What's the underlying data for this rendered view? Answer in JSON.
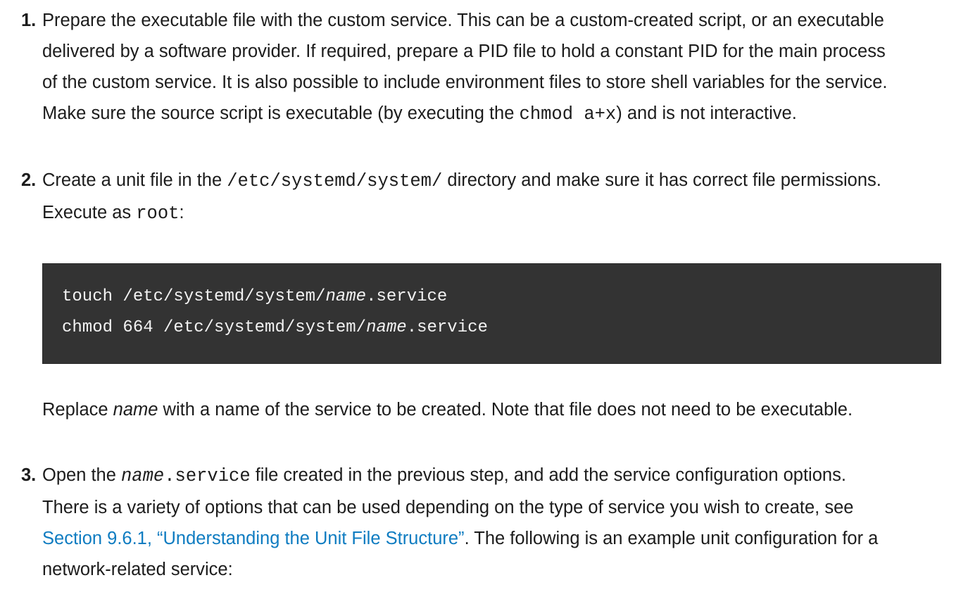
{
  "steps": [
    {
      "number": "1.",
      "lines": {
        "l1": "Prepare the executable file with the custom service. This can be a custom-created script, or an executable",
        "l2": "delivered by a software provider. If required, prepare a PID file to hold a constant PID for the main process",
        "l3": "of the custom service. It is also possible to include environment files to store shell variables for the service.",
        "l4_a": "Make sure the source script is executable (by executing the ",
        "l4_code": "chmod a+x",
        "l4_b": ") and is not interactive."
      }
    },
    {
      "number": "2.",
      "lines": {
        "l1_a": "Create a unit file in the ",
        "l1_code": "/etc/systemd/system/",
        "l1_b": " directory and make sure it has correct file permissions.",
        "l2_a": "Execute as ",
        "l2_code": "root",
        "l2_b": ":"
      },
      "code_block": {
        "line1_a": "touch /etc/systemd/system/",
        "line1_name": "name",
        "line1_b": ".service",
        "line2_a": "chmod 664 /etc/systemd/system/",
        "line2_name": "name",
        "line2_b": ".service"
      },
      "note": {
        "a": "Replace ",
        "name": "name",
        "b": " with a name of the service to be created. Note that file does not need to be executable."
      }
    },
    {
      "number": "3.",
      "lines": {
        "l1_a": "Open the ",
        "l1_code_name": "name",
        "l1_code_rest": ".service",
        "l1_b": " file created in the previous step, and add the service configuration options.",
        "l2": "There is a variety of options that can be used depending on the type of service you wish to create, see",
        "l3_link": "Section 9.6.1, “Understanding the Unit File Structure”",
        "l3_b": ". The following is an example unit configuration for a",
        "l4": "network-related service:"
      }
    }
  ]
}
